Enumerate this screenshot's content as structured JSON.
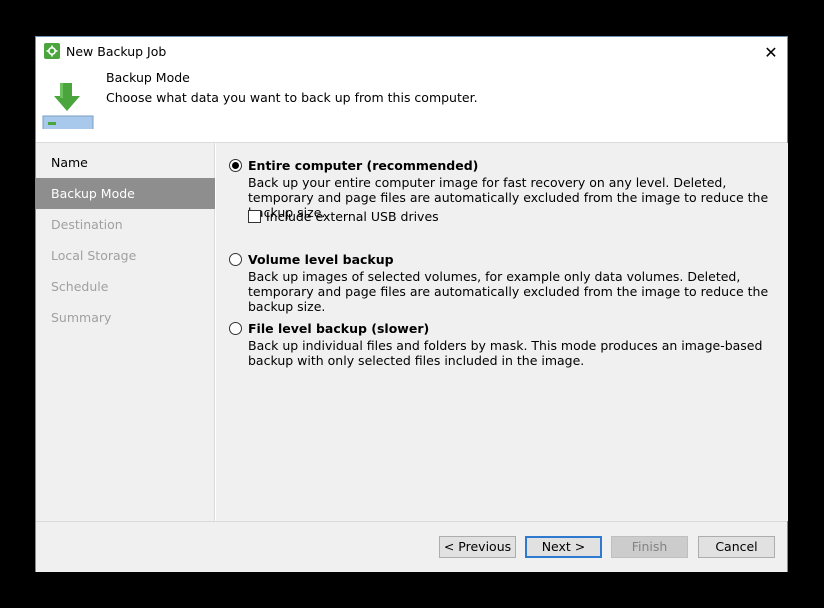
{
  "window": {
    "title": "New Backup Job",
    "close_glyph": "✕"
  },
  "header": {
    "title": "Backup Mode",
    "subtitle": "Choose what data you want to back up from this computer.",
    "icon": "download-to-drive-icon"
  },
  "sidebar": {
    "items": [
      {
        "label": "Name",
        "state": "normal"
      },
      {
        "label": "Backup Mode",
        "state": "selected"
      },
      {
        "label": "Destination",
        "state": "disabled"
      },
      {
        "label": "Local Storage",
        "state": "disabled"
      },
      {
        "label": "Schedule",
        "state": "disabled"
      },
      {
        "label": "Summary",
        "state": "disabled"
      }
    ]
  },
  "options": [
    {
      "title": "Entire computer (recommended)",
      "description": "Back up your entire computer image for fast recovery on any level. Deleted, temporary and page files are automatically excluded from the image to reduce the backup size.",
      "selected": true
    },
    {
      "title": "Volume level backup",
      "description": "Back up images of selected volumes, for example only data volumes. Deleted, temporary and page files are automatically excluded from the image to reduce the backup size.",
      "selected": false
    },
    {
      "title": "File level backup (slower)",
      "description": "Back up individual files and folders by mask. This mode produces an image-based backup with only selected files included in the image.",
      "selected": false
    }
  ],
  "usb_checkbox": {
    "label": "Include external USB drives",
    "checked": false
  },
  "buttons": {
    "previous": "< Previous",
    "next": "Next >",
    "finish": "Finish",
    "cancel": "Cancel"
  },
  "colors": {
    "accent_green": "#4aa53d",
    "selected_item": "#8e8e8e",
    "primary_border": "#2f7ad1"
  }
}
